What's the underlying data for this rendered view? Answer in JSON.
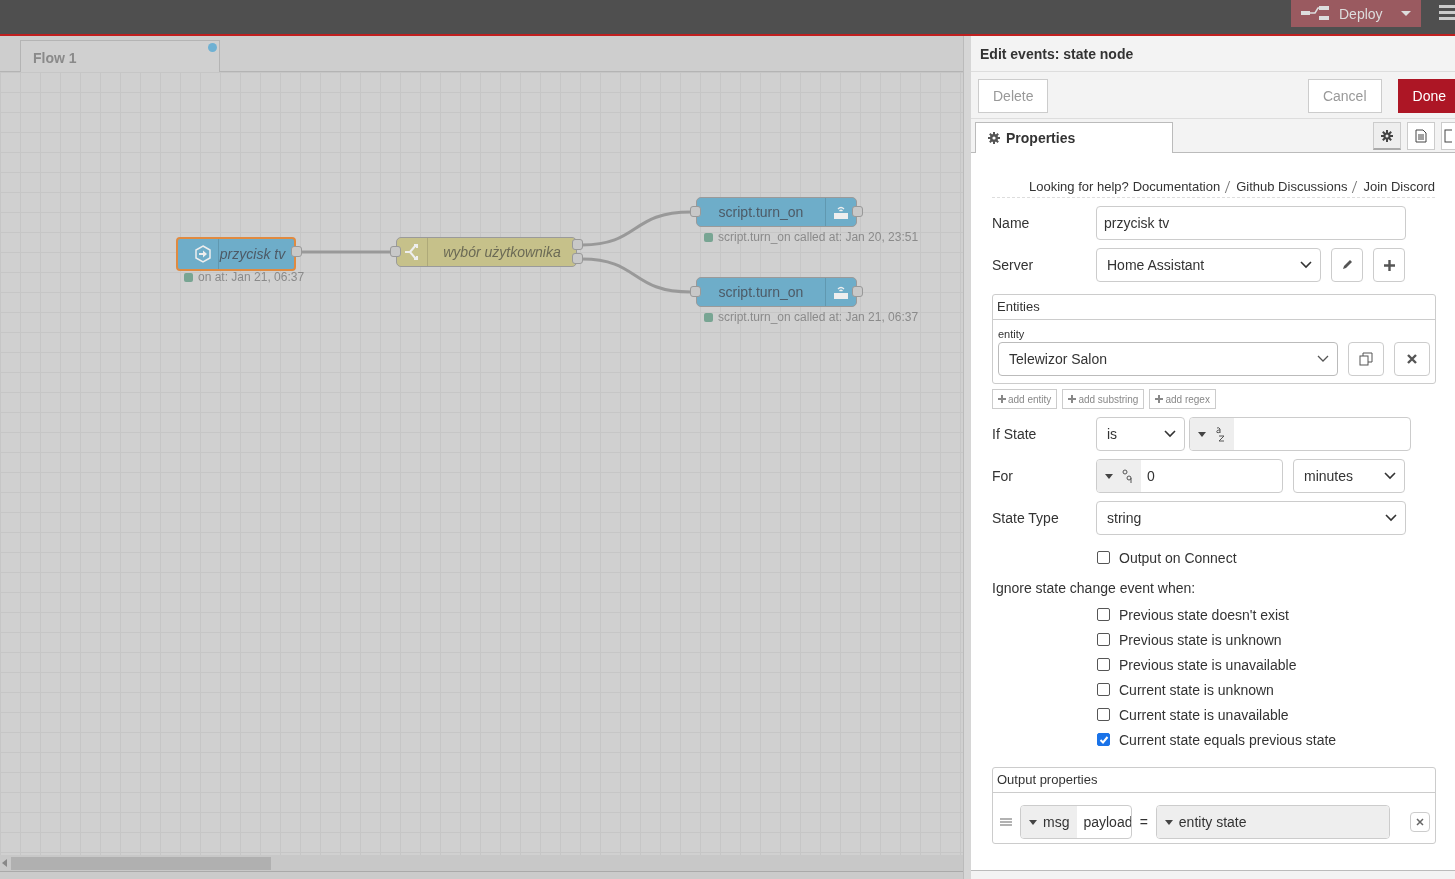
{
  "header": {
    "deploy": "Deploy"
  },
  "workspace": {
    "tabs": [
      {
        "label": "Flow 1",
        "selected": true,
        "changed": true
      }
    ],
    "nodes": [
      {
        "kind": "inject",
        "label": "przycisk tv",
        "selected": true,
        "status": "on at: Jan 21, 06:37"
      },
      {
        "kind": "switch",
        "label": "wybór użytkownika",
        "selected": false
      },
      {
        "kind": "service",
        "label": "script.turn_on",
        "selected": false,
        "status": "script.turn_on called at: Jan 20, 23:51"
      },
      {
        "kind": "service",
        "label": "script.turn_on",
        "selected": false,
        "status": "script.turn_on called at: Jan 21, 06:37"
      }
    ]
  },
  "editor": {
    "title": "Edit events: state node",
    "delete": "Delete",
    "cancel": "Cancel",
    "done": "Done",
    "tab": "Properties",
    "help": {
      "prefix": "Looking for help?",
      "links": [
        "Documentation",
        "Github Discussions",
        "Join Discord"
      ]
    },
    "name": {
      "label": "Name",
      "value": "przycisk tv"
    },
    "server": {
      "label": "Server",
      "value": "Home Assistant"
    },
    "entities": {
      "legend": "Entities",
      "entity_label": "entity",
      "entity": "Telewizor Salon",
      "add": [
        "add entity",
        "add substring",
        "add regex"
      ]
    },
    "if_state": {
      "label": "If State",
      "operator": "is"
    },
    "for": {
      "label": "For",
      "value": "0",
      "unit": "minutes"
    },
    "state_type": {
      "label": "State Type",
      "value": "string"
    },
    "output_on_connect": {
      "label": "Output on Connect",
      "checked": false
    },
    "ignore": {
      "heading": "Ignore state change event when:",
      "options": [
        {
          "label": "Previous state doesn't exist",
          "checked": false
        },
        {
          "label": "Previous state is unknown",
          "checked": false
        },
        {
          "label": "Previous state is unavailable",
          "checked": false
        },
        {
          "label": "Current state is unknown",
          "checked": false
        },
        {
          "label": "Current state is unavailable",
          "checked": false
        },
        {
          "label": "Current state equals previous state",
          "checked": true
        }
      ]
    },
    "output_properties": {
      "legend": "Output properties",
      "rows": [
        {
          "target_type": "msg",
          "target": "payload",
          "equals": "=",
          "value": "entity state"
        }
      ]
    }
  }
}
